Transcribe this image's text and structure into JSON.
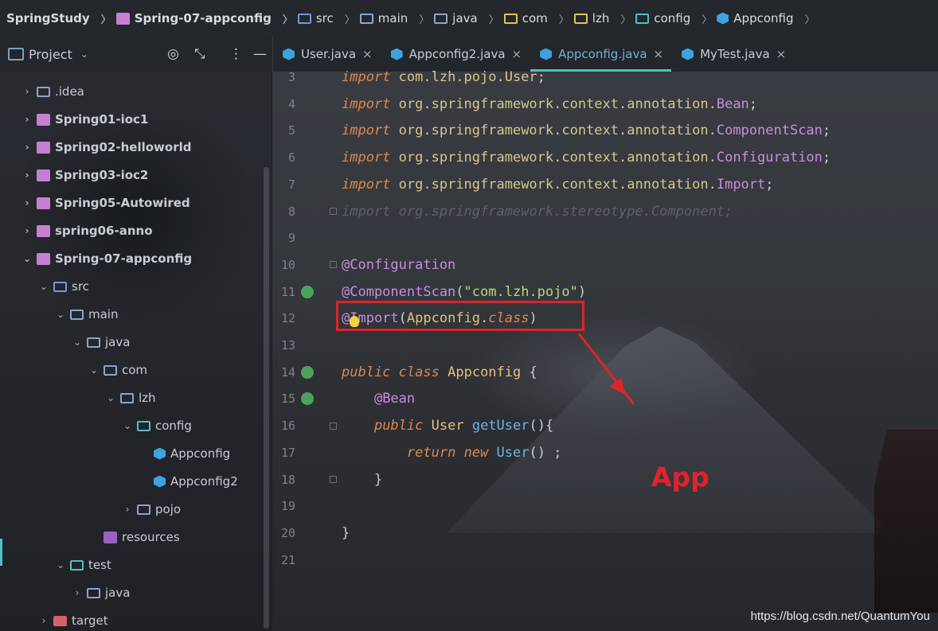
{
  "breadcrumb": [
    {
      "label": "SpringStudy",
      "icon": "none",
      "bold": true
    },
    {
      "label": "Spring-07-appconfig",
      "icon": "module-icon",
      "bold": true
    },
    {
      "label": "src",
      "icon": "src-folder-icon"
    },
    {
      "label": "main",
      "icon": "folder-icon"
    },
    {
      "label": "java",
      "icon": "folder-icon"
    },
    {
      "label": "com",
      "icon": "package-folder-icon"
    },
    {
      "label": "lzh",
      "icon": "package-folder-icon"
    },
    {
      "label": "config",
      "icon": "config-folder-icon"
    },
    {
      "label": "Appconfig",
      "icon": "class-icon"
    }
  ],
  "project_panel": {
    "title": "Project",
    "tools": [
      "target-icon",
      "collapse-icon",
      "more-icon",
      "minimize-icon"
    ]
  },
  "tree": [
    {
      "label": ".idea",
      "indent": 0,
      "arrow": "›",
      "icon": "folder-icon",
      "bold": false
    },
    {
      "label": "Spring01-ioc1",
      "indent": 0,
      "arrow": "›",
      "icon": "module-icon",
      "bold": true
    },
    {
      "label": "Spring02-helloworld",
      "indent": 0,
      "arrow": "›",
      "icon": "module-icon",
      "bold": true
    },
    {
      "label": "Spring03-ioc2",
      "indent": 0,
      "arrow": "›",
      "icon": "module-icon",
      "bold": true
    },
    {
      "label": "Spring05-Autowired",
      "indent": 0,
      "arrow": "›",
      "icon": "module-icon",
      "bold": true
    },
    {
      "label": "spring06-anno",
      "indent": 0,
      "arrow": "›",
      "icon": "module-icon",
      "bold": true
    },
    {
      "label": "Spring-07-appconfig",
      "indent": 0,
      "arrow": "⌄",
      "icon": "module-icon",
      "bold": true
    },
    {
      "label": "src",
      "indent": 1,
      "arrow": "⌄",
      "icon": "src-folder-icon",
      "bold": false
    },
    {
      "label": "main",
      "indent": 2,
      "arrow": "⌄",
      "icon": "folder-icon",
      "bold": false
    },
    {
      "label": "java",
      "indent": 3,
      "arrow": "⌄",
      "icon": "folder-icon",
      "bold": false
    },
    {
      "label": "com",
      "indent": 4,
      "arrow": "⌄",
      "icon": "folder-icon",
      "bold": false
    },
    {
      "label": "lzh",
      "indent": 5,
      "arrow": "⌄",
      "icon": "folder-icon",
      "bold": false
    },
    {
      "label": "config",
      "indent": 6,
      "arrow": "⌄",
      "icon": "config-folder-icon",
      "bold": false
    },
    {
      "label": "Appconfig",
      "indent": 7,
      "arrow": "",
      "icon": "class-icon",
      "bold": false
    },
    {
      "label": "Appconfig2",
      "indent": 7,
      "arrow": "",
      "icon": "class-icon",
      "bold": false
    },
    {
      "label": "pojo",
      "indent": 6,
      "arrow": "›",
      "icon": "folder-icon",
      "bold": false
    },
    {
      "label": "resources",
      "indent": 4,
      "arrow": "",
      "icon": "resources-folder-icon",
      "bold": false
    },
    {
      "label": "test",
      "indent": 2,
      "arrow": "⌄",
      "icon": "test-folder-icon",
      "bold": false
    },
    {
      "label": "java",
      "indent": 3,
      "arrow": "›",
      "icon": "folder-icon",
      "bold": false
    },
    {
      "label": "target",
      "indent": 1,
      "arrow": "›",
      "icon": "target-folder-icon",
      "bold": false
    }
  ],
  "tabs": [
    {
      "label": "User.java",
      "active": false
    },
    {
      "label": "Appconfig2.java",
      "active": false
    },
    {
      "label": "Appconfig.java",
      "active": true
    },
    {
      "label": "MyTest.java",
      "active": false
    }
  ],
  "code_lines": [
    {
      "num": "3",
      "tokens": [
        [
          "kw",
          "import"
        ],
        [
          "plain",
          " "
        ],
        [
          "pkg",
          "com.lzh.pojo.User"
        ],
        [
          "plain",
          ";"
        ]
      ]
    },
    {
      "num": "4",
      "tokens": [
        [
          "kw",
          "import"
        ],
        [
          "plain",
          " "
        ],
        [
          "pkg",
          "org.springframework.context.annotation."
        ],
        [
          "cls",
          "Bean"
        ],
        [
          "plain",
          ";"
        ]
      ]
    },
    {
      "num": "5",
      "tokens": [
        [
          "kw",
          "import"
        ],
        [
          "plain",
          " "
        ],
        [
          "pkg",
          "org.springframework.context.annotation."
        ],
        [
          "cls",
          "ComponentScan"
        ],
        [
          "plain",
          ";"
        ]
      ]
    },
    {
      "num": "6",
      "tokens": [
        [
          "kw",
          "import"
        ],
        [
          "plain",
          " "
        ],
        [
          "pkg",
          "org.springframework.context.annotation."
        ],
        [
          "cls",
          "Configuration"
        ],
        [
          "plain",
          ";"
        ]
      ]
    },
    {
      "num": "7",
      "tokens": [
        [
          "kw",
          "import"
        ],
        [
          "plain",
          " "
        ],
        [
          "pkg",
          "org.springframework.context.annotation."
        ],
        [
          "cls",
          "Import"
        ],
        [
          "plain",
          ";"
        ]
      ]
    },
    {
      "num": "8",
      "tokens": [
        [
          "dim",
          "import org.springframework.stereotype.Component;"
        ]
      ]
    },
    {
      "num": "9",
      "tokens": []
    },
    {
      "num": "10",
      "tokens": [
        [
          "ann",
          "@Configuration"
        ]
      ]
    },
    {
      "num": "11",
      "tokens": [
        [
          "ann",
          "@ComponentScan"
        ],
        [
          "plain",
          "("
        ],
        [
          "str",
          "\"com.lzh.pojo\""
        ],
        [
          "plain",
          ")"
        ]
      ]
    },
    {
      "num": "12",
      "tokens": [
        [
          "ann",
          "@Import"
        ],
        [
          "plain",
          "("
        ],
        [
          "typ",
          "Appconfig"
        ],
        [
          "plain",
          "."
        ],
        [
          "kw",
          "class"
        ],
        [
          "plain",
          ")"
        ]
      ]
    },
    {
      "num": "13",
      "tokens": []
    },
    {
      "num": "14",
      "tokens": [
        [
          "kw",
          "public"
        ],
        [
          "plain",
          " "
        ],
        [
          "kw",
          "class"
        ],
        [
          "plain",
          " "
        ],
        [
          "typ",
          "Appconfig"
        ],
        [
          "plain",
          " {"
        ]
      ]
    },
    {
      "num": "15",
      "tokens": [
        [
          "plain",
          "    "
        ],
        [
          "ann",
          "@Bean"
        ]
      ]
    },
    {
      "num": "16",
      "tokens": [
        [
          "plain",
          "    "
        ],
        [
          "kw",
          "public"
        ],
        [
          "plain",
          " "
        ],
        [
          "typ",
          "User"
        ],
        [
          "plain",
          " "
        ],
        [
          "fn",
          "getUser"
        ],
        [
          "plain",
          "(){"
        ]
      ]
    },
    {
      "num": "17",
      "tokens": [
        [
          "plain",
          "        "
        ],
        [
          "kw",
          "return"
        ],
        [
          "plain",
          " "
        ],
        [
          "kw",
          "new"
        ],
        [
          "plain",
          " "
        ],
        [
          "fn",
          "User"
        ],
        [
          "plain",
          "() ;"
        ]
      ]
    },
    {
      "num": "18",
      "tokens": [
        [
          "plain",
          "    }"
        ]
      ]
    },
    {
      "num": "19",
      "tokens": []
    },
    {
      "num": "20",
      "tokens": [
        [
          "plain",
          "}"
        ]
      ]
    },
    {
      "num": "21",
      "tokens": []
    }
  ],
  "annotation": {
    "label": "App",
    "color": "#e0232a"
  },
  "watermark": "https://blog.csdn.net/QuantumYou"
}
